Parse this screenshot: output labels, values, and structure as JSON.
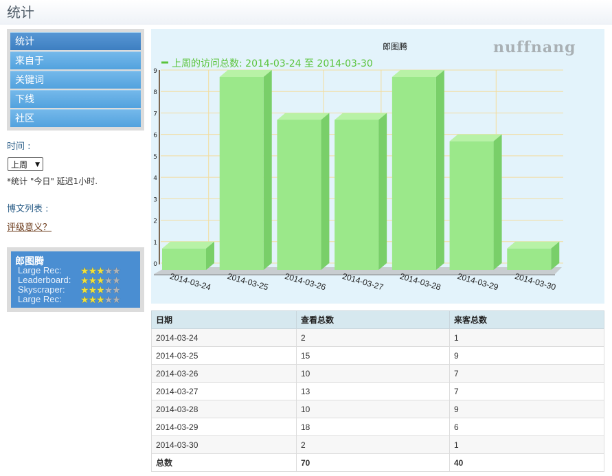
{
  "page": {
    "title": "统计"
  },
  "sidebar": {
    "nav": [
      {
        "label": "统计",
        "active": true
      },
      {
        "label": "来自于",
        "active": false
      },
      {
        "label": "关键词",
        "active": false
      },
      {
        "label": "下线",
        "active": false
      },
      {
        "label": "社区",
        "active": false
      }
    ],
    "time_label": "时间 :",
    "period_value": "上周",
    "note": "*统计 \"今日\" 延迟1小时.",
    "posts_label": "博文列表 :",
    "rating_link": "评级意义？",
    "rating": {
      "name": "郎图腾",
      "rows": [
        {
          "label": "Large Rec:",
          "stars": 3,
          "max": 5
        },
        {
          "label": "Leaderboard:",
          "stars": 3,
          "max": 5
        },
        {
          "label": "Skyscraper:",
          "stars": 3,
          "max": 5
        },
        {
          "label": "Large Rec:",
          "stars": 3,
          "max": 5
        }
      ]
    }
  },
  "chart_data": {
    "type": "bar",
    "title": "郎图腾",
    "legend": "上周的访问总数: 2014-03-24 至 2014-03-30",
    "watermark": "nuffnang",
    "categories": [
      "2014-03-24",
      "2014-03-25",
      "2014-03-26",
      "2014-03-27",
      "2014-03-28",
      "2014-03-29",
      "2014-03-30"
    ],
    "series": [
      {
        "name": "上周的访问总数: 2014-03-24 至 2014-03-30",
        "values": [
          1,
          9,
          7,
          7,
          9,
          6,
          1
        ]
      }
    ],
    "ylim": [
      0,
      9
    ],
    "yticks": [
      0,
      1,
      2,
      3,
      4,
      5,
      6,
      7,
      8,
      9
    ],
    "grid": true,
    "colors": {
      "bar": "#9be88a",
      "bar_top": "#b8f2a6",
      "bar_side": "#79cf69",
      "legend": "#5ac33a",
      "grid": "#f3dc9c",
      "bg": "#e3f3fb"
    }
  },
  "table": {
    "headers": [
      "日期",
      "查看总数",
      "来客总数"
    ],
    "rows": [
      [
        "2014-03-24",
        "2",
        "1"
      ],
      [
        "2014-03-25",
        "15",
        "9"
      ],
      [
        "2014-03-26",
        "10",
        "7"
      ],
      [
        "2014-03-27",
        "13",
        "7"
      ],
      [
        "2014-03-28",
        "10",
        "9"
      ],
      [
        "2014-03-29",
        "18",
        "6"
      ],
      [
        "2014-03-30",
        "2",
        "1"
      ]
    ],
    "totals": [
      "总数",
      "70",
      "40"
    ]
  }
}
